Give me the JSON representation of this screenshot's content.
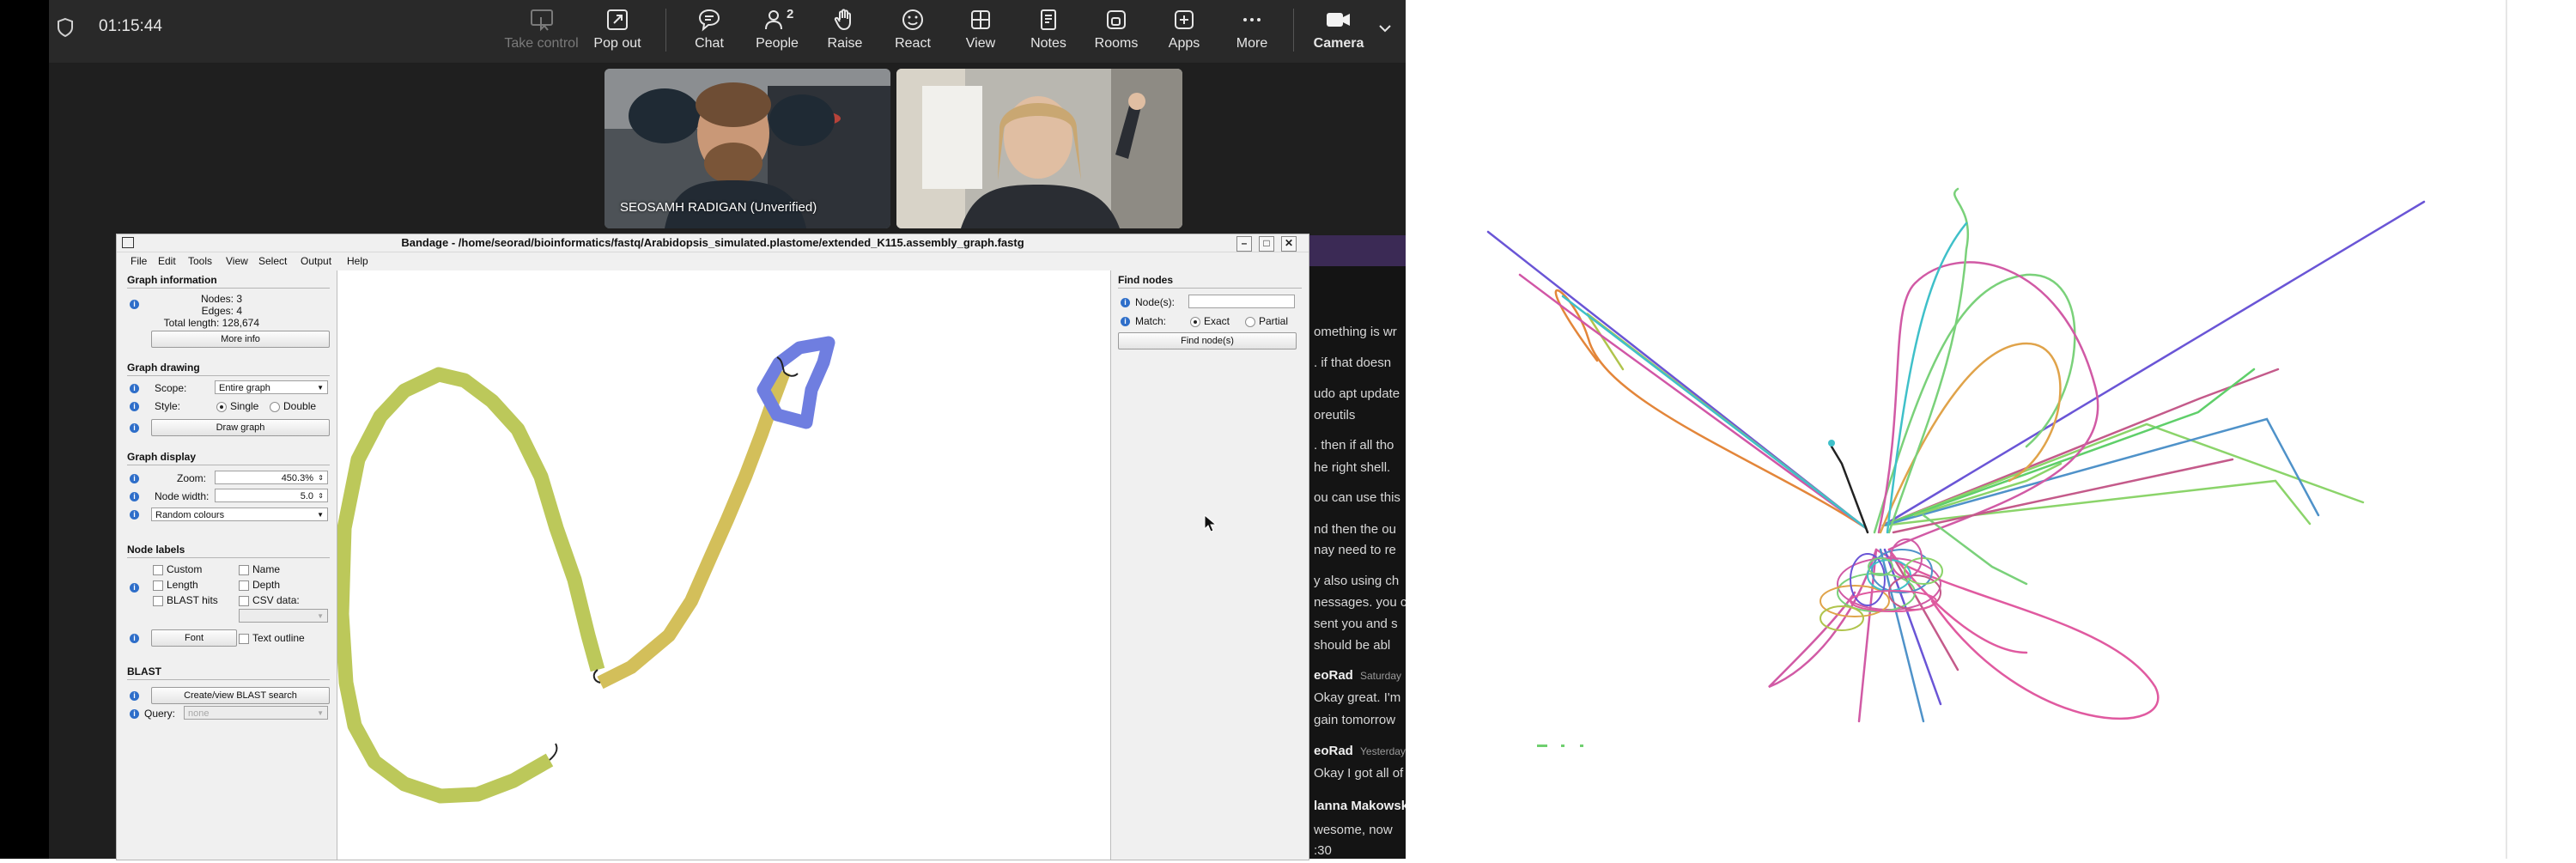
{
  "teams": {
    "timer": "01:15:44",
    "toolbar": [
      {
        "id": "take-control",
        "label": "Take control",
        "icon": "take-control-icon",
        "disabled": true
      },
      {
        "id": "pop-out",
        "label": "Pop out",
        "icon": "pop-out-icon"
      },
      {
        "id": "chat",
        "label": "Chat",
        "icon": "chat-icon"
      },
      {
        "id": "people",
        "label": "People",
        "icon": "people-icon",
        "badge": "2"
      },
      {
        "id": "raise",
        "label": "Raise",
        "icon": "raise-hand-icon"
      },
      {
        "id": "react",
        "label": "React",
        "icon": "react-icon"
      },
      {
        "id": "view",
        "label": "View",
        "icon": "view-grid-icon"
      },
      {
        "id": "notes",
        "label": "Notes",
        "icon": "notes-icon"
      },
      {
        "id": "rooms",
        "label": "Rooms",
        "icon": "rooms-icon"
      },
      {
        "id": "apps",
        "label": "Apps",
        "icon": "apps-icon"
      },
      {
        "id": "more",
        "label": "More",
        "icon": "more-icon"
      },
      {
        "id": "camera",
        "label": "Camera",
        "icon": "camera-icon"
      }
    ],
    "participant_name": "SEOSAMH RADIGAN (Unverified)",
    "chat_fragments": [
      "omething is wr",
      ". if that doesn",
      "udo apt update",
      "oreutils",
      ". then if all tho",
      "he right shell.",
      "ou can use this",
      "nd then the ou",
      "nay need to re",
      "y also using ch",
      "nessages. you c",
      "sent you and s",
      "should be abl",
      "eoRad",
      "Saturday",
      "Okay great. I'm",
      "gain tomorrow",
      "eoRad",
      "Yesterday",
      "Okay I got all of",
      "lanna Makowski",
      "wesome, now",
      ":30"
    ]
  },
  "bandage": {
    "title": "Bandage - /home/seorad/bioinformatics/fastq/Arabidopsis_simulated.plastome/extended_K115.assembly_graph.fastg",
    "menu": [
      "File",
      "Edit",
      "Tools",
      "View",
      "Select",
      "Output",
      "Help"
    ],
    "graph_information": {
      "header": "Graph information",
      "nodes": "Nodes: 3",
      "edges": "Edges: 4",
      "total_length": "Total length: 128,674",
      "more_info": "More info"
    },
    "graph_drawing": {
      "header": "Graph drawing",
      "scope_label": "Scope:",
      "scope_value": "Entire graph",
      "style_label": "Style:",
      "style_single": "Single",
      "style_double": "Double",
      "draw_button": "Draw graph"
    },
    "graph_display": {
      "header": "Graph display",
      "zoom_label": "Zoom:",
      "zoom_value": "450.3%",
      "node_width_label": "Node width:",
      "node_width_value": "5.0",
      "colour_value": "Random colours"
    },
    "node_labels": {
      "header": "Node labels",
      "custom": "Custom",
      "name": "Name",
      "length": "Length",
      "depth": "Depth",
      "blast_hits": "BLAST hits",
      "csv_data": "CSV data:",
      "font_button": "Font",
      "text_outline": "Text outline"
    },
    "blast": {
      "header": "BLAST",
      "search_button": "Create/view BLAST search",
      "query_label": "Query:",
      "query_value": "none"
    },
    "find_nodes": {
      "header": "Find nodes",
      "nodes_label": "Node(s):",
      "match_label": "Match:",
      "exact": "Exact",
      "partial": "Partial",
      "find_button": "Find node(s)"
    },
    "colors": {
      "loop": "#bcc85a",
      "link": "#d3bf5a",
      "link_end": "#c7c455",
      "small": "#6f7ee0"
    }
  }
}
